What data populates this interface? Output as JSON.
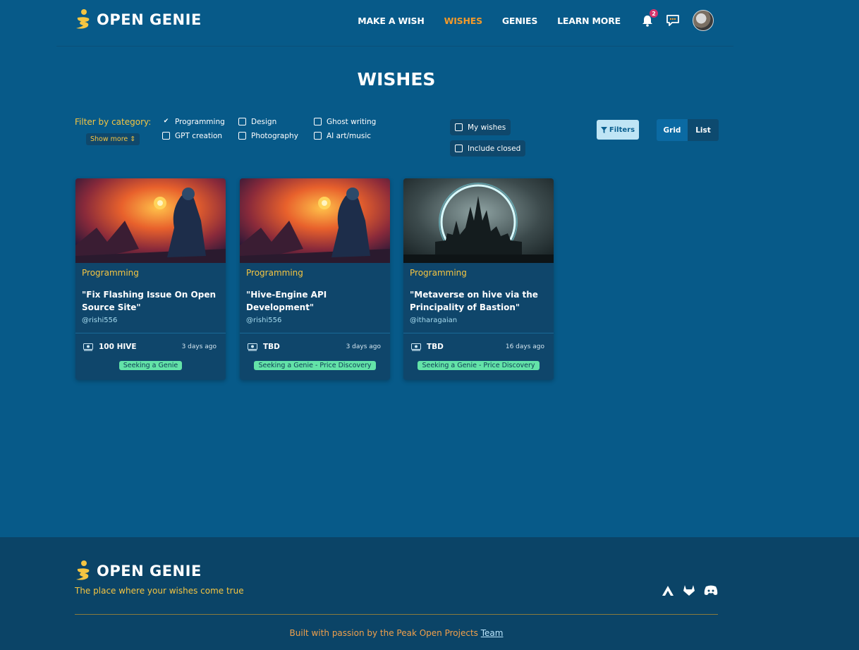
{
  "header": {
    "brand": "OPEN GENIE",
    "nav": [
      "MAKE A WISH",
      "WISHES",
      "GENIES",
      "LEARN MORE"
    ],
    "active_nav": "WISHES",
    "notification_count": "2",
    "icons": [
      "bell-icon",
      "chat-icon",
      "avatar"
    ]
  },
  "page": {
    "title": "WISHES"
  },
  "filters": {
    "label": "Filter by category:",
    "show_more": "Show more",
    "categories": [
      {
        "label": "Programming",
        "checked": true
      },
      {
        "label": "Design",
        "checked": false
      },
      {
        "label": "Ghost writing",
        "checked": false
      },
      {
        "label": "GPT creation",
        "checked": false
      },
      {
        "label": "Photography",
        "checked": false
      },
      {
        "label": "AI art/music",
        "checked": false
      }
    ],
    "my_wishes": "My wishes",
    "include_closed": "Include closed",
    "filters_button": "Filters",
    "view_grid": "Grid",
    "view_list": "List"
  },
  "cards": [
    {
      "category": "Programming",
      "title": "\"Fix Flashing Issue On Open Source Site\"",
      "author": "@rishi556",
      "price": "100 HIVE",
      "time": "3 days ago",
      "status": "Seeking a Genie",
      "image": "genie-fire-illustration"
    },
    {
      "category": "Programming",
      "title": "\"Hive-Engine API Development\"",
      "author": "@rishi556",
      "price": "TBD",
      "time": "3 days ago",
      "status": "Seeking a Genie - Price Discovery",
      "image": "genie-fire-illustration"
    },
    {
      "category": "Programming",
      "title": "\"Metaverse on hive via the Principality of Bastion\"",
      "author": "@itharagaian",
      "price": "TBD",
      "time": "16 days ago",
      "status": "Seeking a Genie - Price Discovery",
      "image": "castle-portal-illustration"
    }
  ],
  "footer": {
    "brand": "OPEN GENIE",
    "tagline": "The place where your wishes come true",
    "credit": "Built with passion by the Peak Open Projects",
    "credit_link": "Team",
    "icons": [
      "hive-icon",
      "gitlab-icon",
      "discord-icon"
    ]
  },
  "colors": {
    "background": "#075a89",
    "accent": "#f39a2a",
    "yellow": "#f5c542",
    "status_green": "#63e3a8",
    "card": "#0f466b",
    "footer": "#0b4467"
  }
}
